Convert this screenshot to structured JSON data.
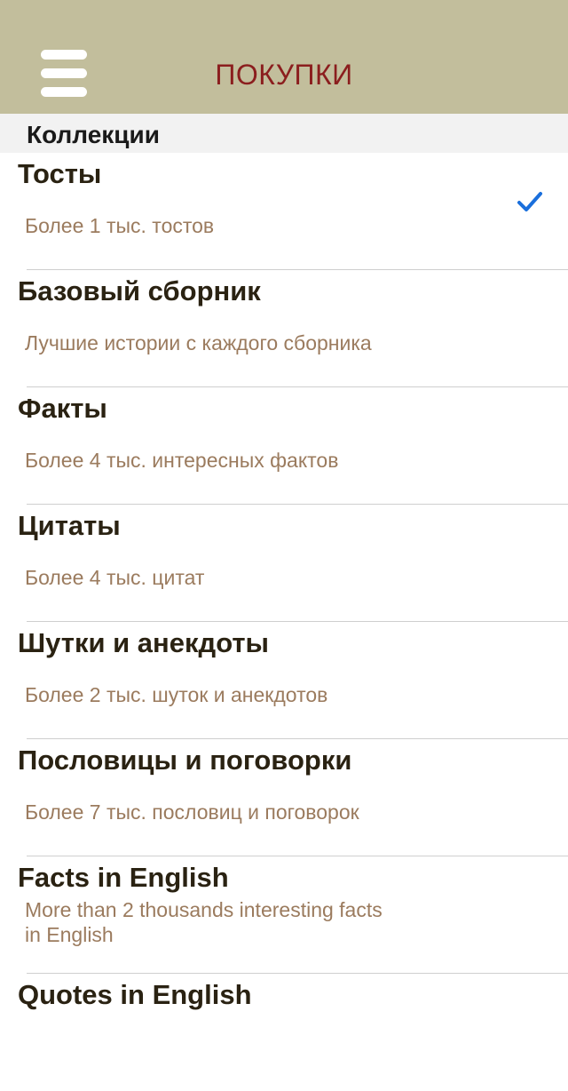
{
  "navbar": {
    "title": "ПОКУПКИ",
    "menu_icon": "hamburger-menu-icon",
    "background_color": "#c2be9c",
    "title_color": "#8b1e1e"
  },
  "section": {
    "header": "Коллекции"
  },
  "items": [
    {
      "title": "Тосты",
      "subtitle": "Более 1 тыс. тостов",
      "checked": true
    },
    {
      "title": "Базовый сборник",
      "subtitle": "Лучшие истории с каждого сборника",
      "checked": false
    },
    {
      "title": "Факты",
      "subtitle": "Более 4 тыс. интересных фактов",
      "checked": false
    },
    {
      "title": "Цитаты",
      "subtitle": "Более 4 тыс. цитат",
      "checked": false
    },
    {
      "title": "Шутки и анекдоты",
      "subtitle": "Более 2 тыс. шуток и анекдотов",
      "checked": false
    },
    {
      "title": "Пословицы и поговорки",
      "subtitle": "Более 7 тыс. пословиц и поговорок",
      "checked": false
    },
    {
      "title": "Facts in English",
      "subtitle": "More than 2 thousands interesting facts in English",
      "checked": false
    },
    {
      "title": "Quotes in English",
      "subtitle": "",
      "checked": false
    }
  ],
  "check_icon": "checkmark-icon",
  "check_color": "#1a6fdc"
}
